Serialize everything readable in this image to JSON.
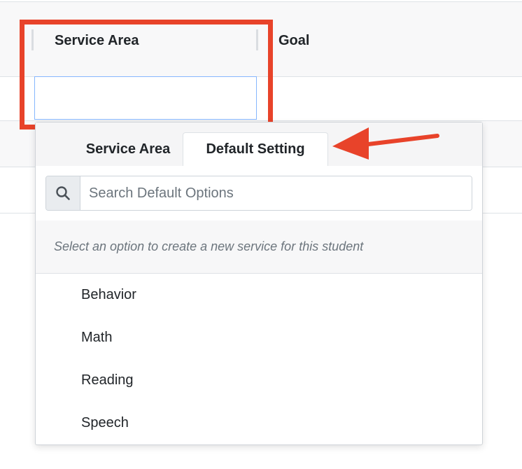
{
  "table": {
    "columns": [
      {
        "label": "Service Area"
      },
      {
        "label": "Goal"
      }
    ],
    "filter_value": ""
  },
  "dropdown": {
    "tabs": [
      {
        "label": "Service Area",
        "active": false
      },
      {
        "label": "Default Setting",
        "active": true
      }
    ],
    "search": {
      "placeholder": "Search Default Options",
      "value": ""
    },
    "hint": "Select an option to create a new service for this student",
    "options": [
      "Behavior",
      "Math",
      "Reading",
      "Speech"
    ]
  },
  "annotation": {
    "highlight_color": "#e8432a",
    "arrow_color": "#e8432a"
  },
  "icons": {
    "search": "search-icon"
  }
}
